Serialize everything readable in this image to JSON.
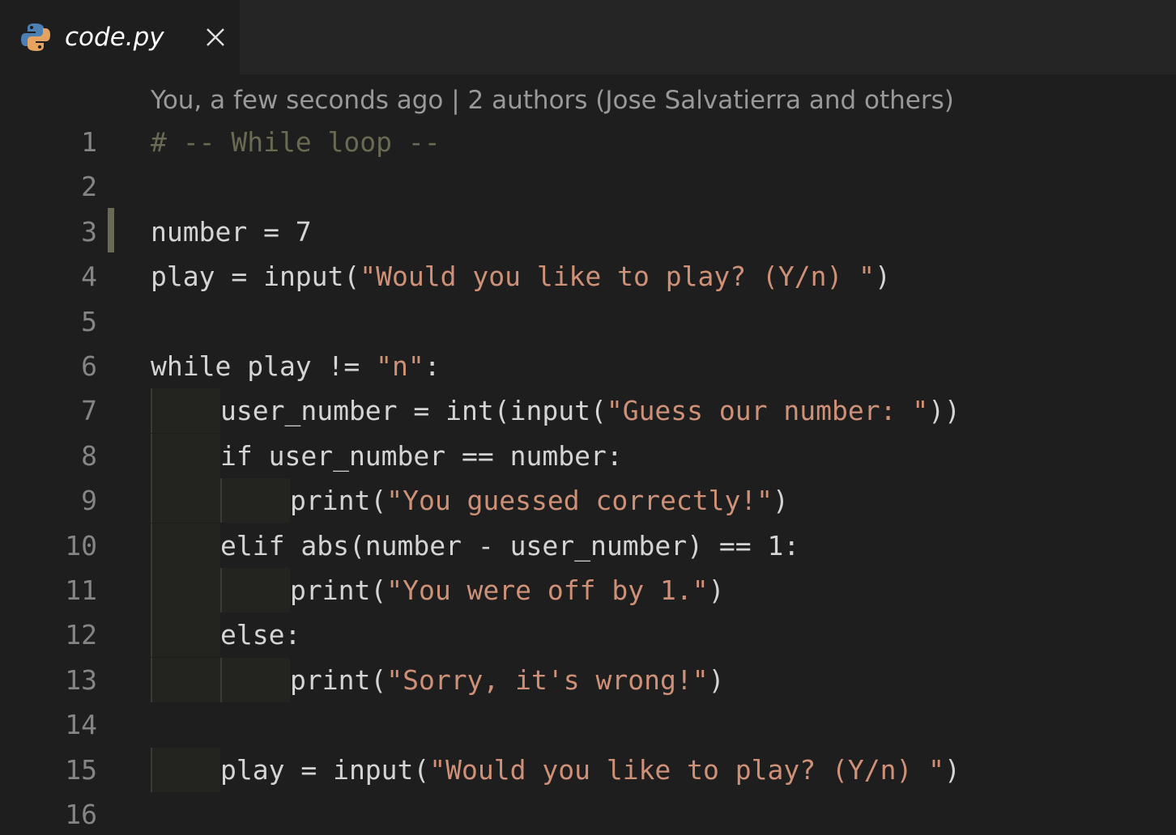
{
  "tab": {
    "icon": "python-icon",
    "label": "code.py",
    "close_glyph": "✕"
  },
  "codelens": "You, a few seconds ago | 2 authors (Jose Salvatierra and others)",
  "colors": {
    "background": "#1e1e1e",
    "comment": "#6a6a52",
    "string": "#ce9178",
    "default": "#d4d4d4",
    "line_number": "#858585"
  },
  "lines": [
    {
      "number": "1",
      "indent": 0,
      "tokens": [
        {
          "text": "# -- While loop --",
          "type": "comment"
        }
      ]
    },
    {
      "number": "2",
      "indent": 0,
      "tokens": []
    },
    {
      "number": "3",
      "indent": 0,
      "tokens": [
        {
          "text": "number = 7",
          "type": "default"
        }
      ]
    },
    {
      "number": "4",
      "indent": 0,
      "tokens": [
        {
          "text": "play = input(",
          "type": "default"
        },
        {
          "text": "\"Would you like to play? (Y/n) \"",
          "type": "string"
        },
        {
          "text": ")",
          "type": "default"
        }
      ]
    },
    {
      "number": "5",
      "indent": 0,
      "tokens": []
    },
    {
      "number": "6",
      "indent": 0,
      "tokens": [
        {
          "text": "while play != ",
          "type": "default"
        },
        {
          "text": "\"n\"",
          "type": "string"
        },
        {
          "text": ":",
          "type": "default"
        }
      ]
    },
    {
      "number": "7",
      "indent": 1,
      "tokens": [
        {
          "text": "user_number = int(input(",
          "type": "default"
        },
        {
          "text": "\"Guess our number: \"",
          "type": "string"
        },
        {
          "text": "))",
          "type": "default"
        }
      ]
    },
    {
      "number": "8",
      "indent": 1,
      "tokens": [
        {
          "text": "if user_number == number:",
          "type": "default"
        }
      ]
    },
    {
      "number": "9",
      "indent": 2,
      "tokens": [
        {
          "text": "print(",
          "type": "default"
        },
        {
          "text": "\"You guessed correctly!\"",
          "type": "string"
        },
        {
          "text": ")",
          "type": "default"
        }
      ]
    },
    {
      "number": "10",
      "indent": 1,
      "tokens": [
        {
          "text": "elif abs(number - user_number) == 1:",
          "type": "default"
        }
      ]
    },
    {
      "number": "11",
      "indent": 2,
      "tokens": [
        {
          "text": "print(",
          "type": "default"
        },
        {
          "text": "\"You were off by 1.\"",
          "type": "string"
        },
        {
          "text": ")",
          "type": "default"
        }
      ]
    },
    {
      "number": "12",
      "indent": 1,
      "tokens": [
        {
          "text": "else:",
          "type": "default"
        }
      ]
    },
    {
      "number": "13",
      "indent": 2,
      "tokens": [
        {
          "text": "print(",
          "type": "default"
        },
        {
          "text": "\"Sorry, it's wrong!\"",
          "type": "string"
        },
        {
          "text": ")",
          "type": "default"
        }
      ]
    },
    {
      "number": "14",
      "indent": 0,
      "tokens": []
    },
    {
      "number": "15",
      "indent": 1,
      "tokens": [
        {
          "text": "play = input(",
          "type": "default"
        },
        {
          "text": "\"Would you like to play? (Y/n) \"",
          "type": "string"
        },
        {
          "text": ")",
          "type": "default"
        }
      ]
    },
    {
      "number": "16",
      "indent": 0,
      "tokens": []
    }
  ]
}
